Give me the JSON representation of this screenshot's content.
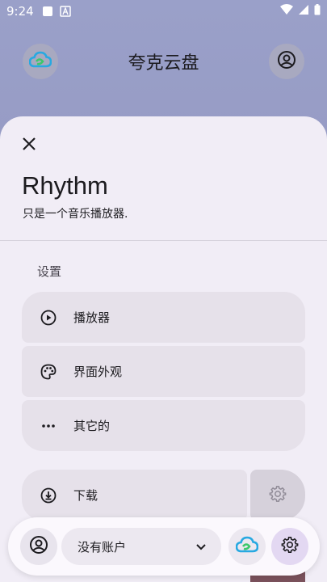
{
  "status_bar": {
    "time": "9:24"
  },
  "header": {
    "title": "夸克云盘",
    "left_icon": "cloud-logo-icon",
    "right_icon": "account-circle-icon"
  },
  "sheet": {
    "title": "Rhythm",
    "subtitle": "只是一个音乐播放器.",
    "section_label": "设置",
    "items": [
      {
        "label": "播放器",
        "icon": "play-circle-icon"
      },
      {
        "label": "界面外观",
        "icon": "palette-icon"
      },
      {
        "label": "其它的",
        "icon": "more-horiz-icon"
      }
    ],
    "download": {
      "label": "下载",
      "icon": "download-circle-icon"
    }
  },
  "account_bar": {
    "select_value": "没有账户",
    "colors": {
      "accent": "#e3d8f2"
    }
  }
}
